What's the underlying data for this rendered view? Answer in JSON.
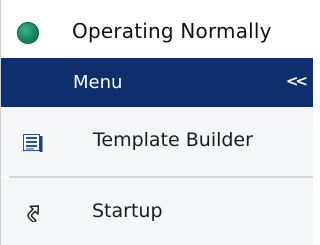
{
  "status": {
    "text": "Operating Normally",
    "indicator_color": "#14835c",
    "icon": "status-indicator-icon"
  },
  "menu": {
    "title": "Menu",
    "collapse_label": "<<",
    "bar_color": "#0d2f6e",
    "items": [
      {
        "label": "Template Builder",
        "icon": "list-document-icon"
      },
      {
        "label": "Startup",
        "icon": "shortcut-arrow-icon"
      }
    ]
  }
}
